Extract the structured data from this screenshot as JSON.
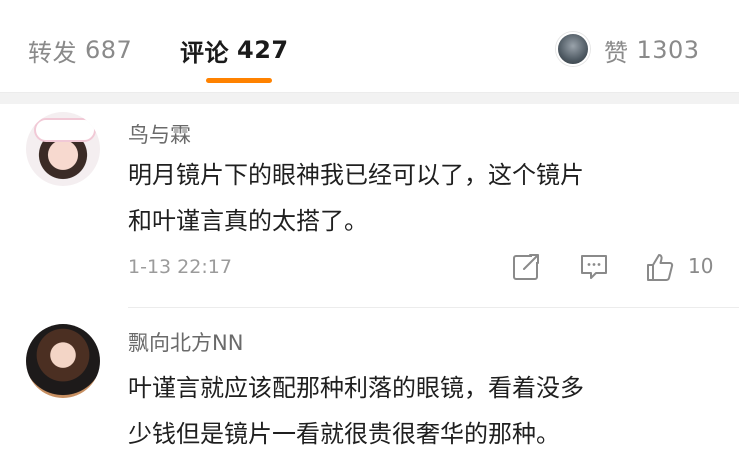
{
  "stats": {
    "reposts_label": "转发",
    "reposts_count": "687",
    "comments_label": "评论",
    "comments_count": "427",
    "likes_label": "赞",
    "likes_count": "1303",
    "active_tab": "comments"
  },
  "comments": [
    {
      "username": "鸟与霖",
      "lines": [
        "明月镜片下的眼神我已经可以了，这个镜片",
        "和叶谨言真的太搭了。"
      ],
      "timestamp": "1-13 22:17",
      "like_count": "10"
    },
    {
      "username": "飘向北方NN",
      "lines": [
        "叶谨言就应该配那种利落的眼镜，看着没多",
        "少钱但是镜片一看就很贵很奢华的那种。"
      ]
    }
  ],
  "icons": {
    "repost": "repost-icon",
    "reply": "comment-icon",
    "like": "thumbs-up-icon"
  },
  "colors": {
    "accent": "#ff8200",
    "muted_text": "#8a8a8a",
    "primary_text": "#1f1f1f",
    "separator": "#f2f2f2"
  }
}
